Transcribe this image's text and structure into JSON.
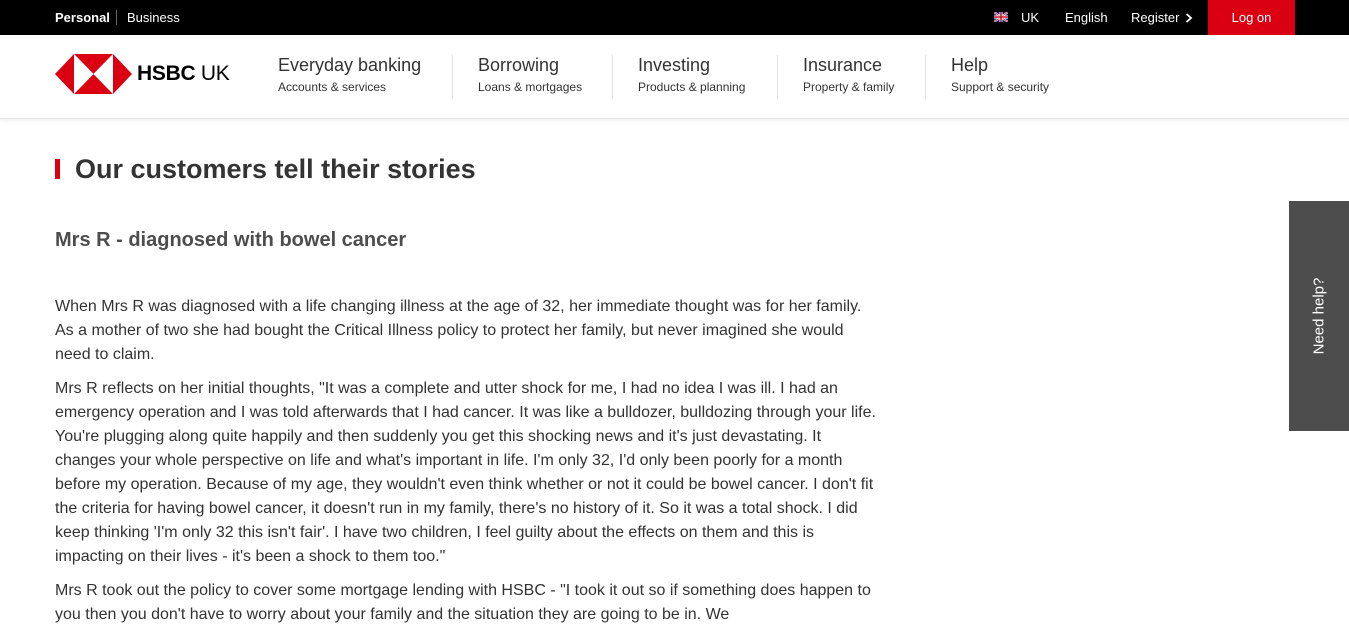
{
  "topbar": {
    "segments": [
      "Personal",
      "Business"
    ],
    "country": "UK",
    "language": "English",
    "register": "Register",
    "logon": "Log on"
  },
  "brand": {
    "name_bold": "HSBC",
    "name_rest": " UK",
    "accent": "#db0011"
  },
  "nav": [
    {
      "title": "Everyday banking",
      "sub": "Accounts & services"
    },
    {
      "title": "Borrowing",
      "sub": "Loans & mortgages"
    },
    {
      "title": "Investing",
      "sub": "Products & planning"
    },
    {
      "title": "Insurance",
      "sub": "Property & family"
    },
    {
      "title": "Help",
      "sub": "Support & security"
    }
  ],
  "page": {
    "title": "Our customers tell their stories",
    "subtitle": "Mrs R - diagnosed with bowel cancer",
    "paragraphs": [
      "When Mrs R was diagnosed with a life changing illness at the age of 32, her immediate thought was for her family. As a mother of two she had bought the Critical Illness policy to protect her family, but never imagined she would need to claim.",
      "Mrs R reflects on her initial thoughts, \"It was a complete and utter shock for me, I had no idea I was ill. I had an emergency operation and I was told afterwards that I had cancer. It was like a bulldozer, bulldozing through your life. You're plugging along quite happily and then suddenly you get this shocking news and it's just devastating. It changes your whole perspective on life and what's important in life. I'm only 32, I'd only been poorly for a month before my operation. Because of my age, they wouldn't even think whether or not it could be bowel cancer. I don't fit the criteria for having bowel cancer, it doesn't run in my family, there's no history of it. So it was a total shock. I did keep thinking 'I'm only 32 this isn't fair'. I have two children, I feel guilty about the effects on them and this is impacting on their lives - it's been a shock to them too.\"",
      "Mrs R took out the policy to cover some mortgage lending with HSBC - \"I took it out so if something does happen to you then you don't have to worry about your family and the situation they are going to be in. We"
    ]
  },
  "help_tab": {
    "label": "Need help?"
  },
  "icons": {
    "flag": "uk-flag-icon",
    "chevron": "chevron-right-icon",
    "logo": "hsbc-hexagon-logo"
  }
}
